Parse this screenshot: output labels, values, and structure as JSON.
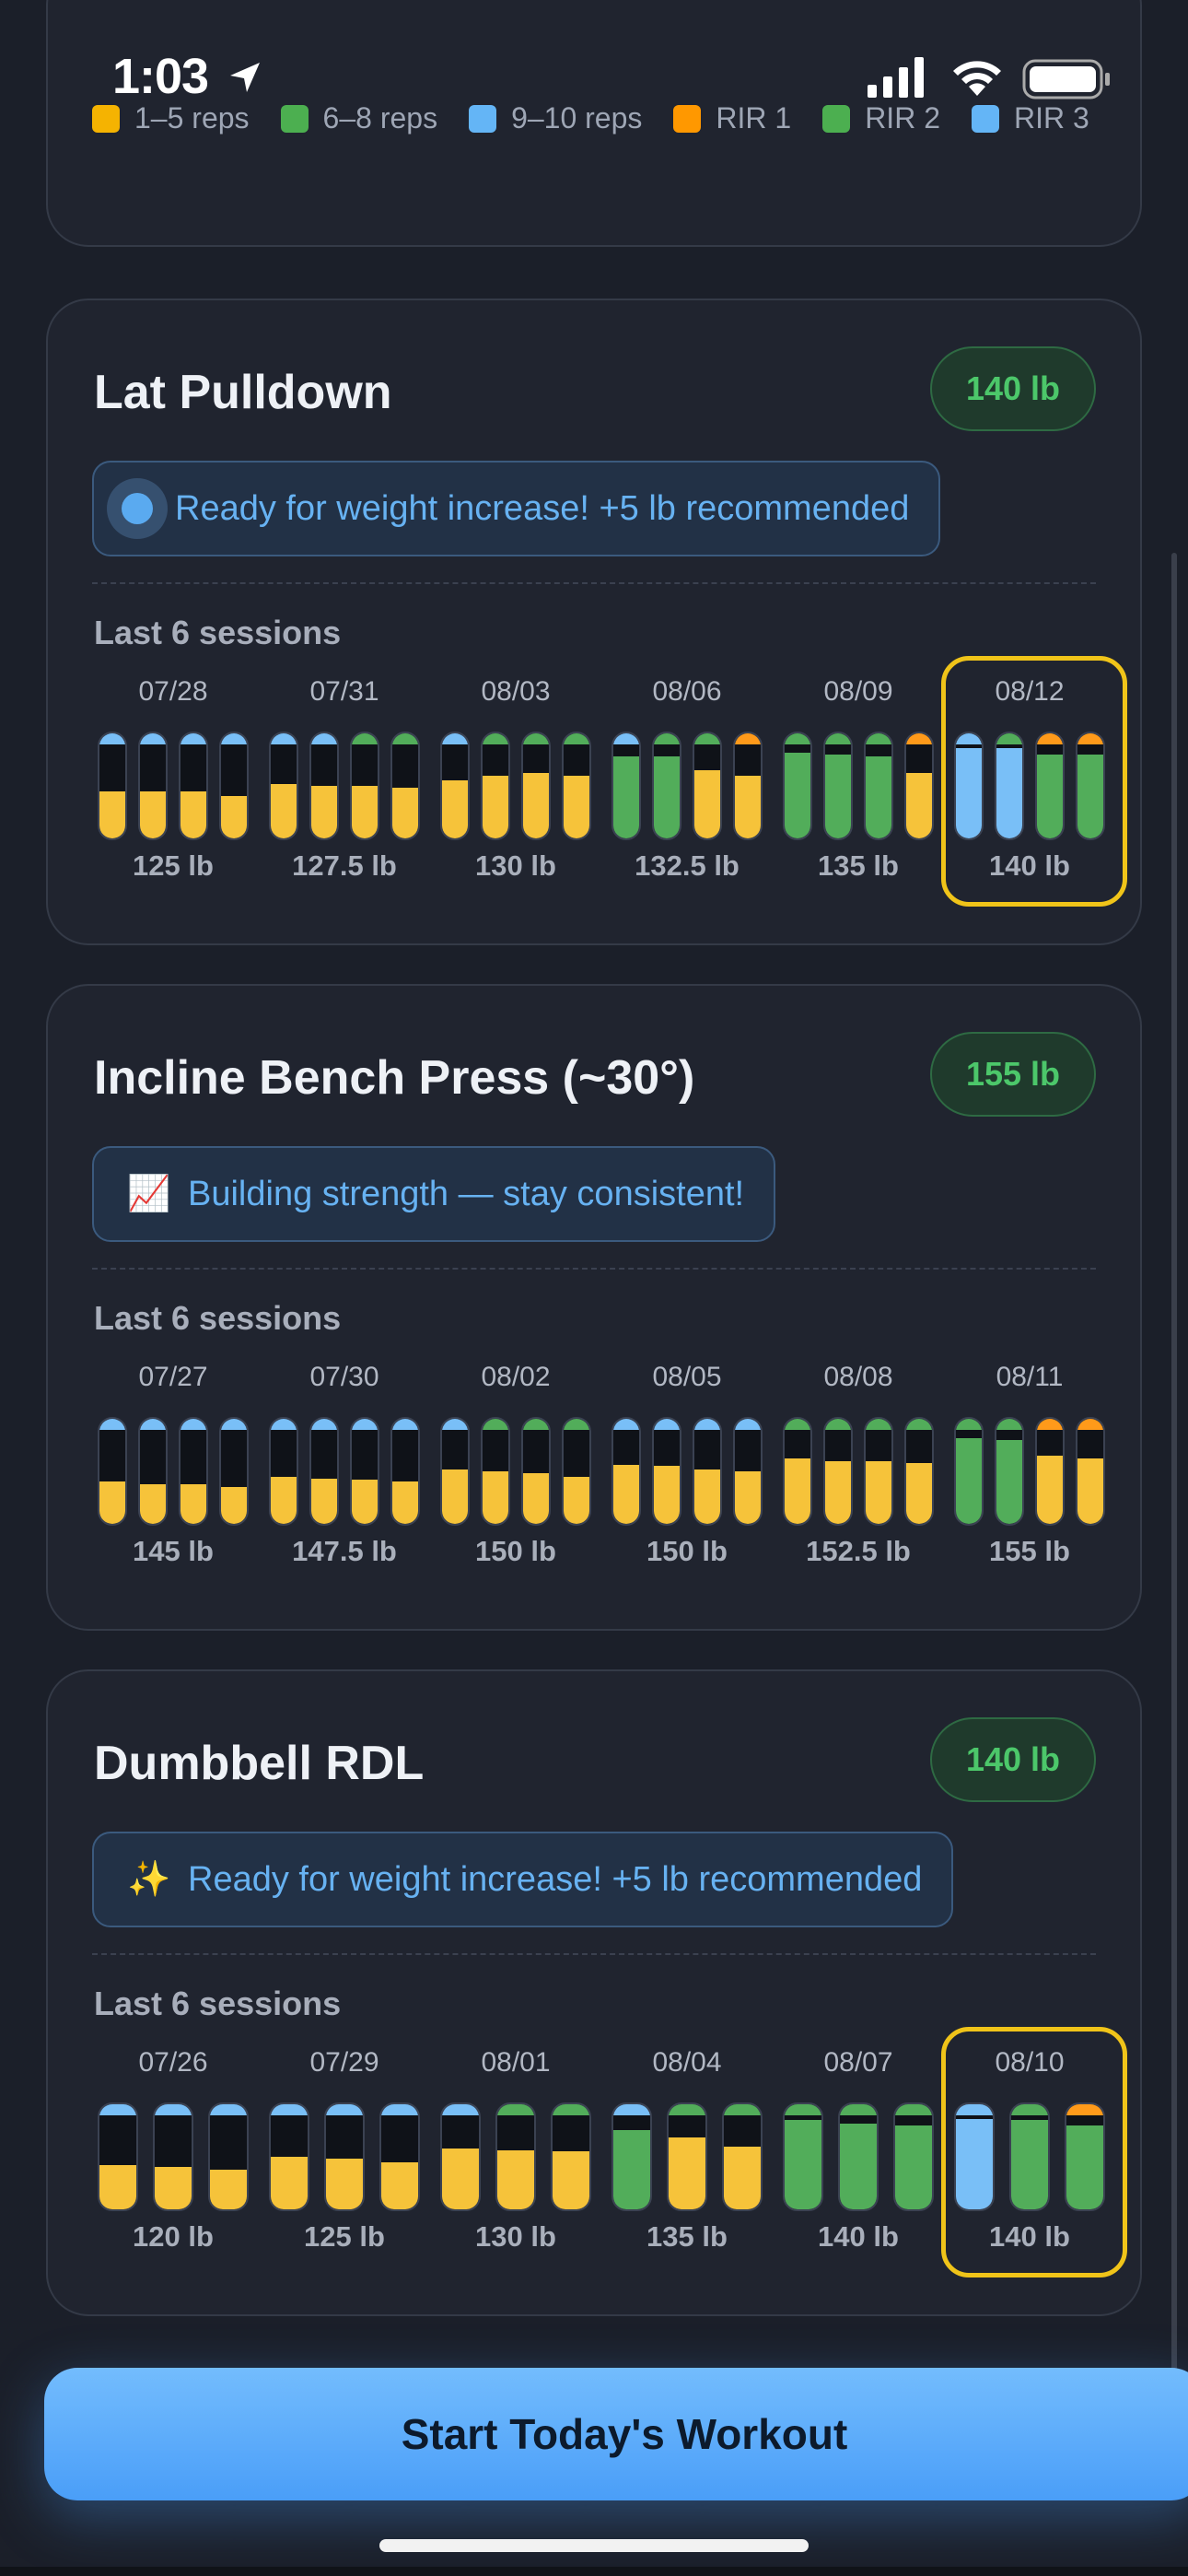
{
  "status_bar": {
    "time": "1:03"
  },
  "legend": [
    {
      "label": "1–5 reps",
      "color": "#f5b301"
    },
    {
      "label": "6–8 reps",
      "color": "#4caf50"
    },
    {
      "label": "9–10 reps",
      "color": "#64b5f6"
    },
    {
      "label": "RIR 1",
      "color": "#ff9800"
    },
    {
      "label": "RIR 2",
      "color": "#4caf50"
    },
    {
      "label": "RIR 3",
      "color": "#64b5f6"
    }
  ],
  "exercises": [
    {
      "name": "Lat Pulldown",
      "current_weight": "140 lb",
      "tip_icon": "target-icon",
      "tip": "Ready for weight increase! +5 lb recommended",
      "sessions_label": "Last 6 sessions",
      "sessions": [
        {
          "date": "07/28",
          "weight": "125 lb",
          "highlighted": false,
          "sets": [
            {
              "fill": "yellow",
              "level": 0.45,
              "cap": "blue"
            },
            {
              "fill": "yellow",
              "level": 0.45,
              "cap": "blue"
            },
            {
              "fill": "yellow",
              "level": 0.45,
              "cap": "blue"
            },
            {
              "fill": "yellow",
              "level": 0.4,
              "cap": "blue"
            }
          ]
        },
        {
          "date": "07/31",
          "weight": "127.5 lb",
          "highlighted": false,
          "sets": [
            {
              "fill": "yellow",
              "level": 0.52,
              "cap": "blue"
            },
            {
              "fill": "yellow",
              "level": 0.5,
              "cap": "blue"
            },
            {
              "fill": "yellow",
              "level": 0.5,
              "cap": "green"
            },
            {
              "fill": "yellow",
              "level": 0.48,
              "cap": "green"
            }
          ]
        },
        {
          "date": "08/03",
          "weight": "130 lb",
          "highlighted": false,
          "sets": [
            {
              "fill": "yellow",
              "level": 0.55,
              "cap": "blue"
            },
            {
              "fill": "yellow",
              "level": 0.6,
              "cap": "green"
            },
            {
              "fill": "yellow",
              "level": 0.62,
              "cap": "green"
            },
            {
              "fill": "yellow",
              "level": 0.6,
              "cap": "green"
            }
          ]
        },
        {
          "date": "08/06",
          "weight": "132.5 lb",
          "highlighted": false,
          "sets": [
            {
              "fill": "green",
              "level": 0.78,
              "cap": "blue"
            },
            {
              "fill": "green",
              "level": 0.78,
              "cap": "green"
            },
            {
              "fill": "yellow",
              "level": 0.65,
              "cap": "green"
            },
            {
              "fill": "yellow",
              "level": 0.6,
              "cap": "orange"
            }
          ]
        },
        {
          "date": "08/09",
          "weight": "135 lb",
          "highlighted": false,
          "sets": [
            {
              "fill": "green",
              "level": 0.82,
              "cap": "green"
            },
            {
              "fill": "green",
              "level": 0.8,
              "cap": "green"
            },
            {
              "fill": "green",
              "level": 0.78,
              "cap": "green"
            },
            {
              "fill": "yellow",
              "level": 0.62,
              "cap": "orange"
            }
          ]
        },
        {
          "date": "08/12",
          "weight": "140 lb",
          "highlighted": true,
          "sets": [
            {
              "fill": "blue",
              "level": 0.9,
              "cap": "blue"
            },
            {
              "fill": "blue",
              "level": 0.9,
              "cap": "green"
            },
            {
              "fill": "green",
              "level": 0.8,
              "cap": "orange"
            },
            {
              "fill": "green",
              "level": 0.8,
              "cap": "orange"
            }
          ]
        }
      ]
    },
    {
      "name": "Incline Bench Press (~30°)",
      "current_weight": "155 lb",
      "tip_icon": "chart-increasing-icon",
      "tip": "Building strength — stay consistent!",
      "sessions_label": "Last 6 sessions",
      "sessions": [
        {
          "date": "07/27",
          "weight": "145 lb",
          "highlighted": false,
          "sets": [
            {
              "fill": "yellow",
              "level": 0.4,
              "cap": "blue"
            },
            {
              "fill": "yellow",
              "level": 0.38,
              "cap": "blue"
            },
            {
              "fill": "yellow",
              "level": 0.38,
              "cap": "blue"
            },
            {
              "fill": "yellow",
              "level": 0.35,
              "cap": "blue"
            }
          ]
        },
        {
          "date": "07/30",
          "weight": "147.5 lb",
          "highlighted": false,
          "sets": [
            {
              "fill": "yellow",
              "level": 0.45,
              "cap": "blue"
            },
            {
              "fill": "yellow",
              "level": 0.43,
              "cap": "blue"
            },
            {
              "fill": "yellow",
              "level": 0.42,
              "cap": "blue"
            },
            {
              "fill": "yellow",
              "level": 0.4,
              "cap": "blue"
            }
          ]
        },
        {
          "date": "08/02",
          "weight": "150 lb",
          "highlighted": false,
          "sets": [
            {
              "fill": "yellow",
              "level": 0.52,
              "cap": "blue"
            },
            {
              "fill": "yellow",
              "level": 0.5,
              "cap": "green"
            },
            {
              "fill": "yellow",
              "level": 0.48,
              "cap": "green"
            },
            {
              "fill": "yellow",
              "level": 0.45,
              "cap": "green"
            }
          ]
        },
        {
          "date": "08/05",
          "weight": "150 lb",
          "highlighted": false,
          "sets": [
            {
              "fill": "yellow",
              "level": 0.56,
              "cap": "blue"
            },
            {
              "fill": "yellow",
              "level": 0.55,
              "cap": "blue"
            },
            {
              "fill": "yellow",
              "level": 0.52,
              "cap": "blue"
            },
            {
              "fill": "yellow",
              "level": 0.5,
              "cap": "blue"
            }
          ]
        },
        {
          "date": "08/08",
          "weight": "152.5 lb",
          "highlighted": false,
          "sets": [
            {
              "fill": "yellow",
              "level": 0.62,
              "cap": "green"
            },
            {
              "fill": "yellow",
              "level": 0.6,
              "cap": "green"
            },
            {
              "fill": "yellow",
              "level": 0.6,
              "cap": "green"
            },
            {
              "fill": "yellow",
              "level": 0.58,
              "cap": "green"
            }
          ]
        },
        {
          "date": "08/11",
          "weight": "155 lb",
          "highlighted": false,
          "sets": [
            {
              "fill": "green",
              "level": 0.82,
              "cap": "green"
            },
            {
              "fill": "green",
              "level": 0.8,
              "cap": "green"
            },
            {
              "fill": "yellow",
              "level": 0.65,
              "cap": "orange"
            },
            {
              "fill": "yellow",
              "level": 0.62,
              "cap": "orange"
            }
          ]
        }
      ]
    },
    {
      "name": "Dumbbell RDL",
      "current_weight": "140 lb",
      "tip_icon": "sparkles-icon",
      "tip": "Ready for weight increase! +5 lb recommended",
      "sessions_label": "Last 6 sessions",
      "sessions": [
        {
          "date": "07/26",
          "weight": "120 lb",
          "highlighted": false,
          "sets": [
            {
              "fill": "yellow",
              "level": 0.42,
              "cap": "blue"
            },
            {
              "fill": "yellow",
              "level": 0.4,
              "cap": "blue"
            },
            {
              "fill": "yellow",
              "level": 0.38,
              "cap": "blue"
            }
          ]
        },
        {
          "date": "07/29",
          "weight": "125 lb",
          "highlighted": false,
          "sets": [
            {
              "fill": "yellow",
              "level": 0.5,
              "cap": "blue"
            },
            {
              "fill": "yellow",
              "level": 0.48,
              "cap": "blue"
            },
            {
              "fill": "yellow",
              "level": 0.45,
              "cap": "blue"
            }
          ]
        },
        {
          "date": "08/01",
          "weight": "130 lb",
          "highlighted": false,
          "sets": [
            {
              "fill": "yellow",
              "level": 0.58,
              "cap": "blue"
            },
            {
              "fill": "yellow",
              "level": 0.56,
              "cap": "green"
            },
            {
              "fill": "yellow",
              "level": 0.55,
              "cap": "green"
            }
          ]
        },
        {
          "date": "08/04",
          "weight": "135 lb",
          "highlighted": false,
          "sets": [
            {
              "fill": "green",
              "level": 0.75,
              "cap": "blue"
            },
            {
              "fill": "yellow",
              "level": 0.68,
              "cap": "green"
            },
            {
              "fill": "yellow",
              "level": 0.6,
              "cap": "green"
            }
          ]
        },
        {
          "date": "08/07",
          "weight": "140 lb",
          "highlighted": false,
          "sets": [
            {
              "fill": "green",
              "level": 0.85,
              "cap": "green"
            },
            {
              "fill": "green",
              "level": 0.82,
              "cap": "green"
            },
            {
              "fill": "green",
              "level": 0.8,
              "cap": "green"
            }
          ]
        },
        {
          "date": "08/10",
          "weight": "140 lb",
          "highlighted": true,
          "sets": [
            {
              "fill": "blue",
              "level": 0.92,
              "cap": "blue"
            },
            {
              "fill": "green",
              "level": 0.85,
              "cap": "green"
            },
            {
              "fill": "green",
              "level": 0.8,
              "cap": "orange"
            }
          ]
        }
      ]
    }
  ],
  "cta_label": "Start Today's Workout",
  "colors": {
    "yellow": "#f6c33a",
    "green": "#52ad5a",
    "blue": "#79bff7",
    "orange": "#ff9a1a",
    "highlight": "#f0c419",
    "accent": "#4a9ef8"
  }
}
